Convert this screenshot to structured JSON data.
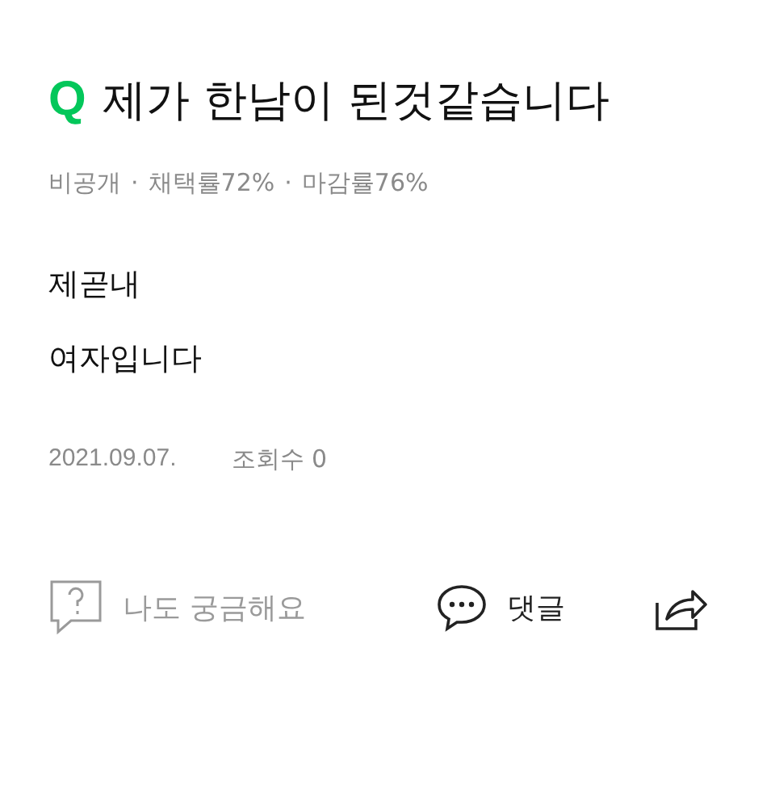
{
  "question": {
    "badge": "Q",
    "title": "제가 한남이 된것같습니다"
  },
  "meta": [
    "비공개",
    "채택률72%",
    "마감률76%"
  ],
  "separator": "·",
  "body": [
    "제곧내",
    "여자입니다"
  ],
  "info": {
    "date": "2021.09.07.",
    "views": "조회수 0"
  },
  "actions": [
    {
      "kind": "curious",
      "label": "나도 궁금해요"
    },
    {
      "kind": "comment",
      "label": "댓글"
    },
    {
      "kind": "share"
    }
  ]
}
